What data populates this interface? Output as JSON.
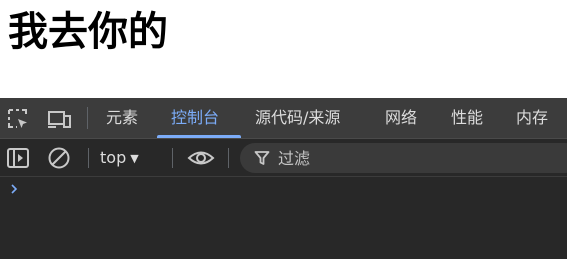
{
  "page": {
    "heading": "我去你的"
  },
  "devtools": {
    "tabs": [
      {
        "label": "元素"
      },
      {
        "label": "控制台"
      },
      {
        "label": "源代码/来源"
      },
      {
        "label": "网络"
      },
      {
        "label": "性能"
      },
      {
        "label": "内存"
      }
    ],
    "active_tab": "控制台",
    "toolbar": {
      "context": "top",
      "filter_placeholder": "过滤"
    },
    "icons": {
      "inspect": "inspect-element-icon",
      "device": "device-toggle-icon",
      "sidebar": "sidebar-toggle-icon",
      "clear": "clear-console-icon",
      "eye": "live-expression-eye-icon",
      "filter": "filter-funnel-icon",
      "prompt": "console-prompt-chevron-icon"
    },
    "colors": {
      "accent": "#7cacf8",
      "panel_bg": "#282828",
      "tabbar_bg": "#3c3c3c",
      "text": "#dcdcdc"
    }
  }
}
